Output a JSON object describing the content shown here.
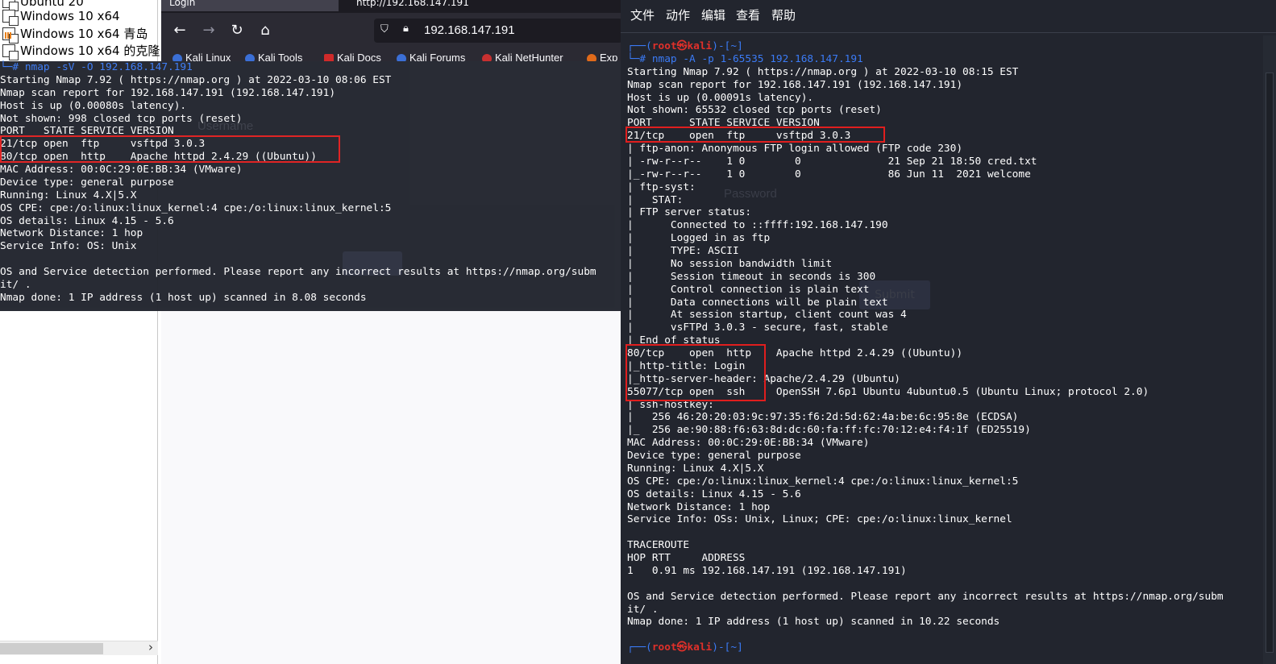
{
  "vm_library": {
    "items": [
      {
        "label": "Ubuntu 20",
        "icon": "vm-icon"
      },
      {
        "label": "Windows 10 x64",
        "icon": "vm-icon"
      },
      {
        "label": "Windows 10 x64 青岛",
        "icon": "vm-icon-orange"
      },
      {
        "label": "Windows 10 x64 的克隆",
        "icon": "vm-icon"
      }
    ],
    "scroll_arrow": "›"
  },
  "browser": {
    "tab1": "Login",
    "tab2": "http://192.168.147.191",
    "url": "192.168.147.191",
    "bookmarks": [
      "Kali Linux",
      "Kali Tools",
      "Kali Docs",
      "Kali Forums",
      "Kali NetHunter",
      "Exp"
    ],
    "ghost": {
      "username": "Username",
      "password": "Password",
      "submit": "Submit"
    }
  },
  "left_terminal": {
    "lines": [
      {
        "type": "cmd",
        "text": "└─# nmap -sV -O 192.168.147.191"
      },
      {
        "type": "out",
        "text": "Starting Nmap 7.92 ( https://nmap.org ) at 2022-03-10 08:06 EST"
      },
      {
        "type": "out",
        "text": "Nmap scan report for 192.168.147.191 (192.168.147.191)"
      },
      {
        "type": "out",
        "text": "Host is up (0.00080s latency)."
      },
      {
        "type": "out",
        "text": "Not shown: 998 closed tcp ports (reset)"
      },
      {
        "type": "out",
        "text": "PORT   STATE SERVICE VERSION"
      },
      {
        "type": "out",
        "text": "21/tcp open  ftp     vsftpd 3.0.3"
      },
      {
        "type": "out",
        "text": "80/tcp open  http    Apache httpd 2.4.29 ((Ubuntu))"
      },
      {
        "type": "out",
        "text": "MAC Address: 00:0C:29:0E:BB:34 (VMware)"
      },
      {
        "type": "out",
        "text": "Device type: general purpose"
      },
      {
        "type": "out",
        "text": "Running: Linux 4.X|5.X"
      },
      {
        "type": "out",
        "text": "OS CPE: cpe:/o:linux:linux_kernel:4 cpe:/o:linux:linux_kernel:5"
      },
      {
        "type": "out",
        "text": "OS details: Linux 4.15 - 5.6"
      },
      {
        "type": "out",
        "text": "Network Distance: 1 hop"
      },
      {
        "type": "out",
        "text": "Service Info: OS: Unix"
      },
      {
        "type": "out",
        "text": ""
      },
      {
        "type": "out",
        "text": "OS and Service detection performed. Please report any incorrect results at https://nmap.org/subm"
      },
      {
        "type": "out",
        "text": "it/ ."
      },
      {
        "type": "out",
        "text": "Nmap done: 1 IP address (1 host up) scanned in 8.08 seconds"
      }
    ]
  },
  "right_terminal": {
    "menu": [
      "文件",
      "动作",
      "编辑",
      "查看",
      "帮助"
    ],
    "prompt_top": "┌──(root㉿kali)-[~]",
    "command": "└─# nmap -A -p 1-65535 192.168.147.191",
    "lines": [
      "Starting Nmap 7.92 ( https://nmap.org ) at 2022-03-10 08:15 EST",
      "Nmap scan report for 192.168.147.191 (192.168.147.191)",
      "Host is up (0.00091s latency).",
      "Not shown: 65532 closed tcp ports (reset)",
      "PORT      STATE SERVICE VERSION",
      "21/tcp    open  ftp     vsftpd 3.0.3",
      "| ftp-anon: Anonymous FTP login allowed (FTP code 230)",
      "| -rw-r--r--    1 0        0              21 Sep 21 18:50 cred.txt",
      "|_-rw-r--r--    1 0        0              86 Jun 11  2021 welcome",
      "| ftp-syst:",
      "|   STAT:",
      "| FTP server status:",
      "|      Connected to ::ffff:192.168.147.190",
      "|      Logged in as ftp",
      "|      TYPE: ASCII",
      "|      No session bandwidth limit",
      "|      Session timeout in seconds is 300",
      "|      Control connection is plain text",
      "|      Data connections will be plain text",
      "|      At session startup, client count was 4",
      "|      vsFTPd 3.0.3 - secure, fast, stable",
      "|_End of status",
      "80/tcp    open  http    Apache httpd 2.4.29 ((Ubuntu))",
      "|_http-title: Login",
      "|_http-server-header: Apache/2.4.29 (Ubuntu)",
      "55077/tcp open  ssh     OpenSSH 7.6p1 Ubuntu 4ubuntu0.5 (Ubuntu Linux; protocol 2.0)",
      "| ssh-hostkey:",
      "|   256 46:20:20:03:9c:97:35:f6:2d:5d:62:4a:be:6c:95:8e (ECDSA)",
      "|_  256 ae:90:88:f6:63:8d:dc:60:fa:ff:fc:70:12:e4:f4:1f (ED25519)",
      "MAC Address: 00:0C:29:0E:BB:34 (VMware)",
      "Device type: general purpose",
      "Running: Linux 4.X|5.X",
      "OS CPE: cpe:/o:linux:linux_kernel:4 cpe:/o:linux:linux_kernel:5",
      "OS details: Linux 4.15 - 5.6",
      "Network Distance: 1 hop",
      "Service Info: OSs: Unix, Linux; CPE: cpe:/o:linux:linux_kernel",
      "",
      "TRACEROUTE",
      "HOP RTT     ADDRESS",
      "1   0.91 ms 192.168.147.191 (192.168.147.191)",
      "",
      "OS and Service detection performed. Please report any incorrect results at https://nmap.org/subm",
      "it/ .",
      "Nmap done: 1 IP address (1 host up) scanned in 10.22 seconds",
      ""
    ],
    "prompt_bottom": "┌──(root㉿kali)-[~]"
  },
  "colors": {
    "terminal_bg": "#22252e",
    "prompt_blue": "#3b7bf6",
    "prompt_red": "#e0302a",
    "highlight_box": "#e01e1e",
    "browser_toolbar": "#2b2a33"
  }
}
